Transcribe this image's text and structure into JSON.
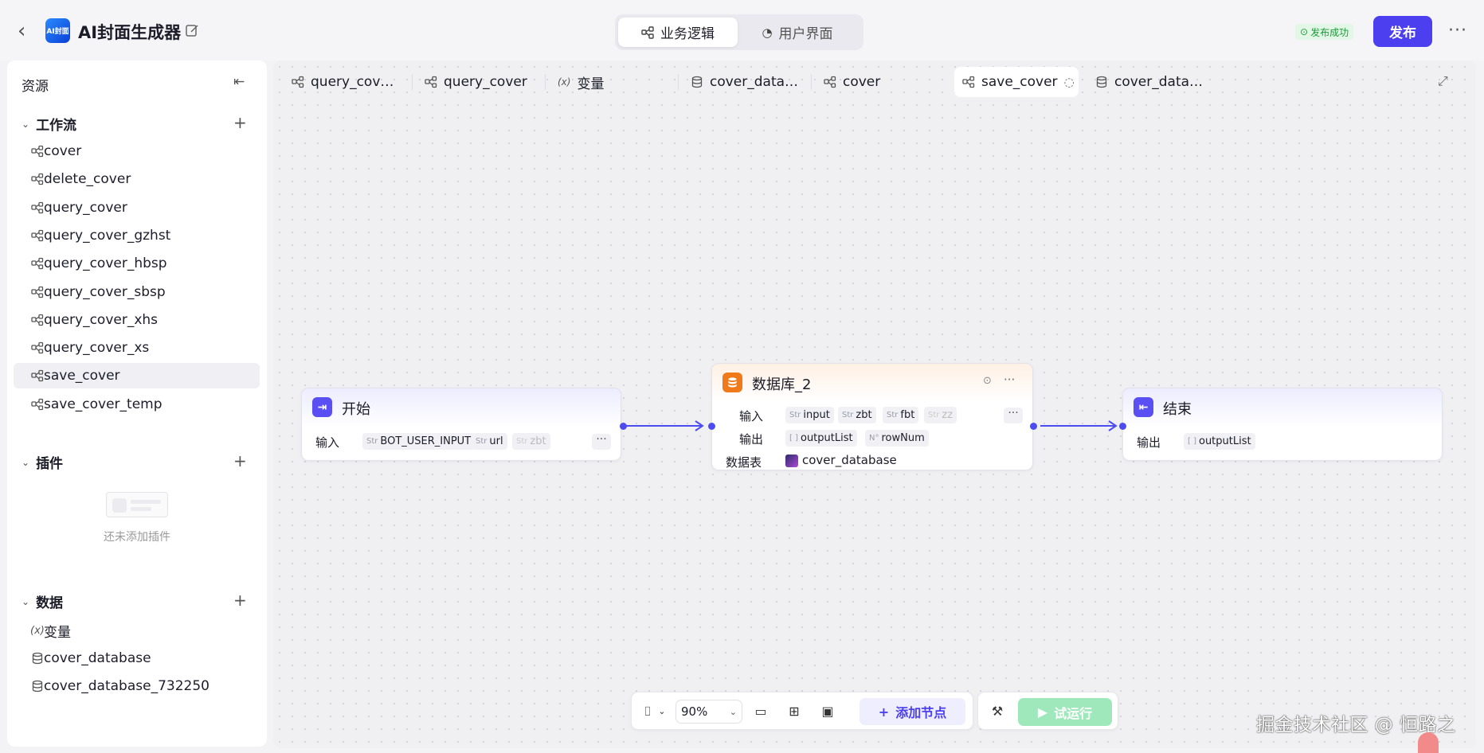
{
  "header": {
    "back_icon": "chevron-left-icon",
    "app_title": "AI封面生成器",
    "app_logo_text": "AI封面",
    "mode_tabs": [
      {
        "label": "业务逻辑",
        "icon": "workflow-icon",
        "active": true
      },
      {
        "label": "用户界面",
        "icon": "palette-icon",
        "active": false
      }
    ],
    "publish_status": "发布成功",
    "publish_label": "发布"
  },
  "sidebar": {
    "title": "资源",
    "sections": {
      "workflow": {
        "title": "工作流",
        "items": [
          "cover",
          "delete_cover",
          "query_cover",
          "query_cover_gzhst",
          "query_cover_hbsp",
          "query_cover_sbsp",
          "query_cover_xhs",
          "query_cover_xs",
          "save_cover",
          "save_cover_temp"
        ],
        "selected": "save_cover"
      },
      "plugins": {
        "title": "插件",
        "empty_text": "还未添加插件"
      },
      "data": {
        "title": "数据",
        "items": [
          {
            "label": "变量",
            "icon": "variable-icon"
          },
          {
            "label": "cover_database",
            "icon": "database-icon"
          },
          {
            "label": "cover_database_732250",
            "icon": "database-icon"
          }
        ]
      }
    }
  },
  "canvas": {
    "tabs": [
      {
        "label": "query_cov…",
        "icon": "workflow-icon"
      },
      {
        "label": "query_cover",
        "icon": "workflow-icon"
      },
      {
        "label": "变量",
        "icon": "variable-icon"
      },
      {
        "label": "cover_data…",
        "icon": "database-icon"
      },
      {
        "label": "cover",
        "icon": "workflow-icon"
      },
      {
        "label": "save_cover",
        "icon": "workflow-icon",
        "active": true
      },
      {
        "label": "cover_data…",
        "icon": "database-icon"
      }
    ],
    "nodes": {
      "start": {
        "title": "开始",
        "input_label": "输入",
        "inputs": [
          {
            "type": "Str",
            "name": "BOT_USER_INPUT"
          },
          {
            "type": "Str",
            "name": "url"
          },
          {
            "type": "Str",
            "name": "zbt"
          }
        ]
      },
      "database": {
        "title": "数据库_2",
        "input_label": "输入",
        "inputs": [
          {
            "type": "Str",
            "name": "input"
          },
          {
            "type": "Str",
            "name": "zbt"
          },
          {
            "type": "Str",
            "name": "fbt"
          },
          {
            "type": "Str",
            "name": "zz"
          }
        ],
        "output_label": "输出",
        "outputs": [
          {
            "type": "[ ]",
            "name": "outputList"
          },
          {
            "type": "N°",
            "name": "rowNum"
          }
        ],
        "table_label": "数据表",
        "table_name": "cover_database"
      },
      "end": {
        "title": "结束",
        "output_label": "输出",
        "outputs": [
          {
            "type": "[ ]",
            "name": "outputList"
          }
        ]
      }
    },
    "toolbar": {
      "zoom": "90%",
      "add_node_label": "添加节点",
      "test_run_label": "试运行"
    }
  },
  "watermark": "掘金技术社区 @ 恒路之",
  "colors": {
    "accent": "#4c3ff0",
    "publish_success": "#1a9a3a",
    "test_run_disabled": "#9ee8bb",
    "start_node_icon": "#5a4ff2",
    "db_node_icon": "#f07a1a",
    "edge": "#4c4cf0"
  }
}
